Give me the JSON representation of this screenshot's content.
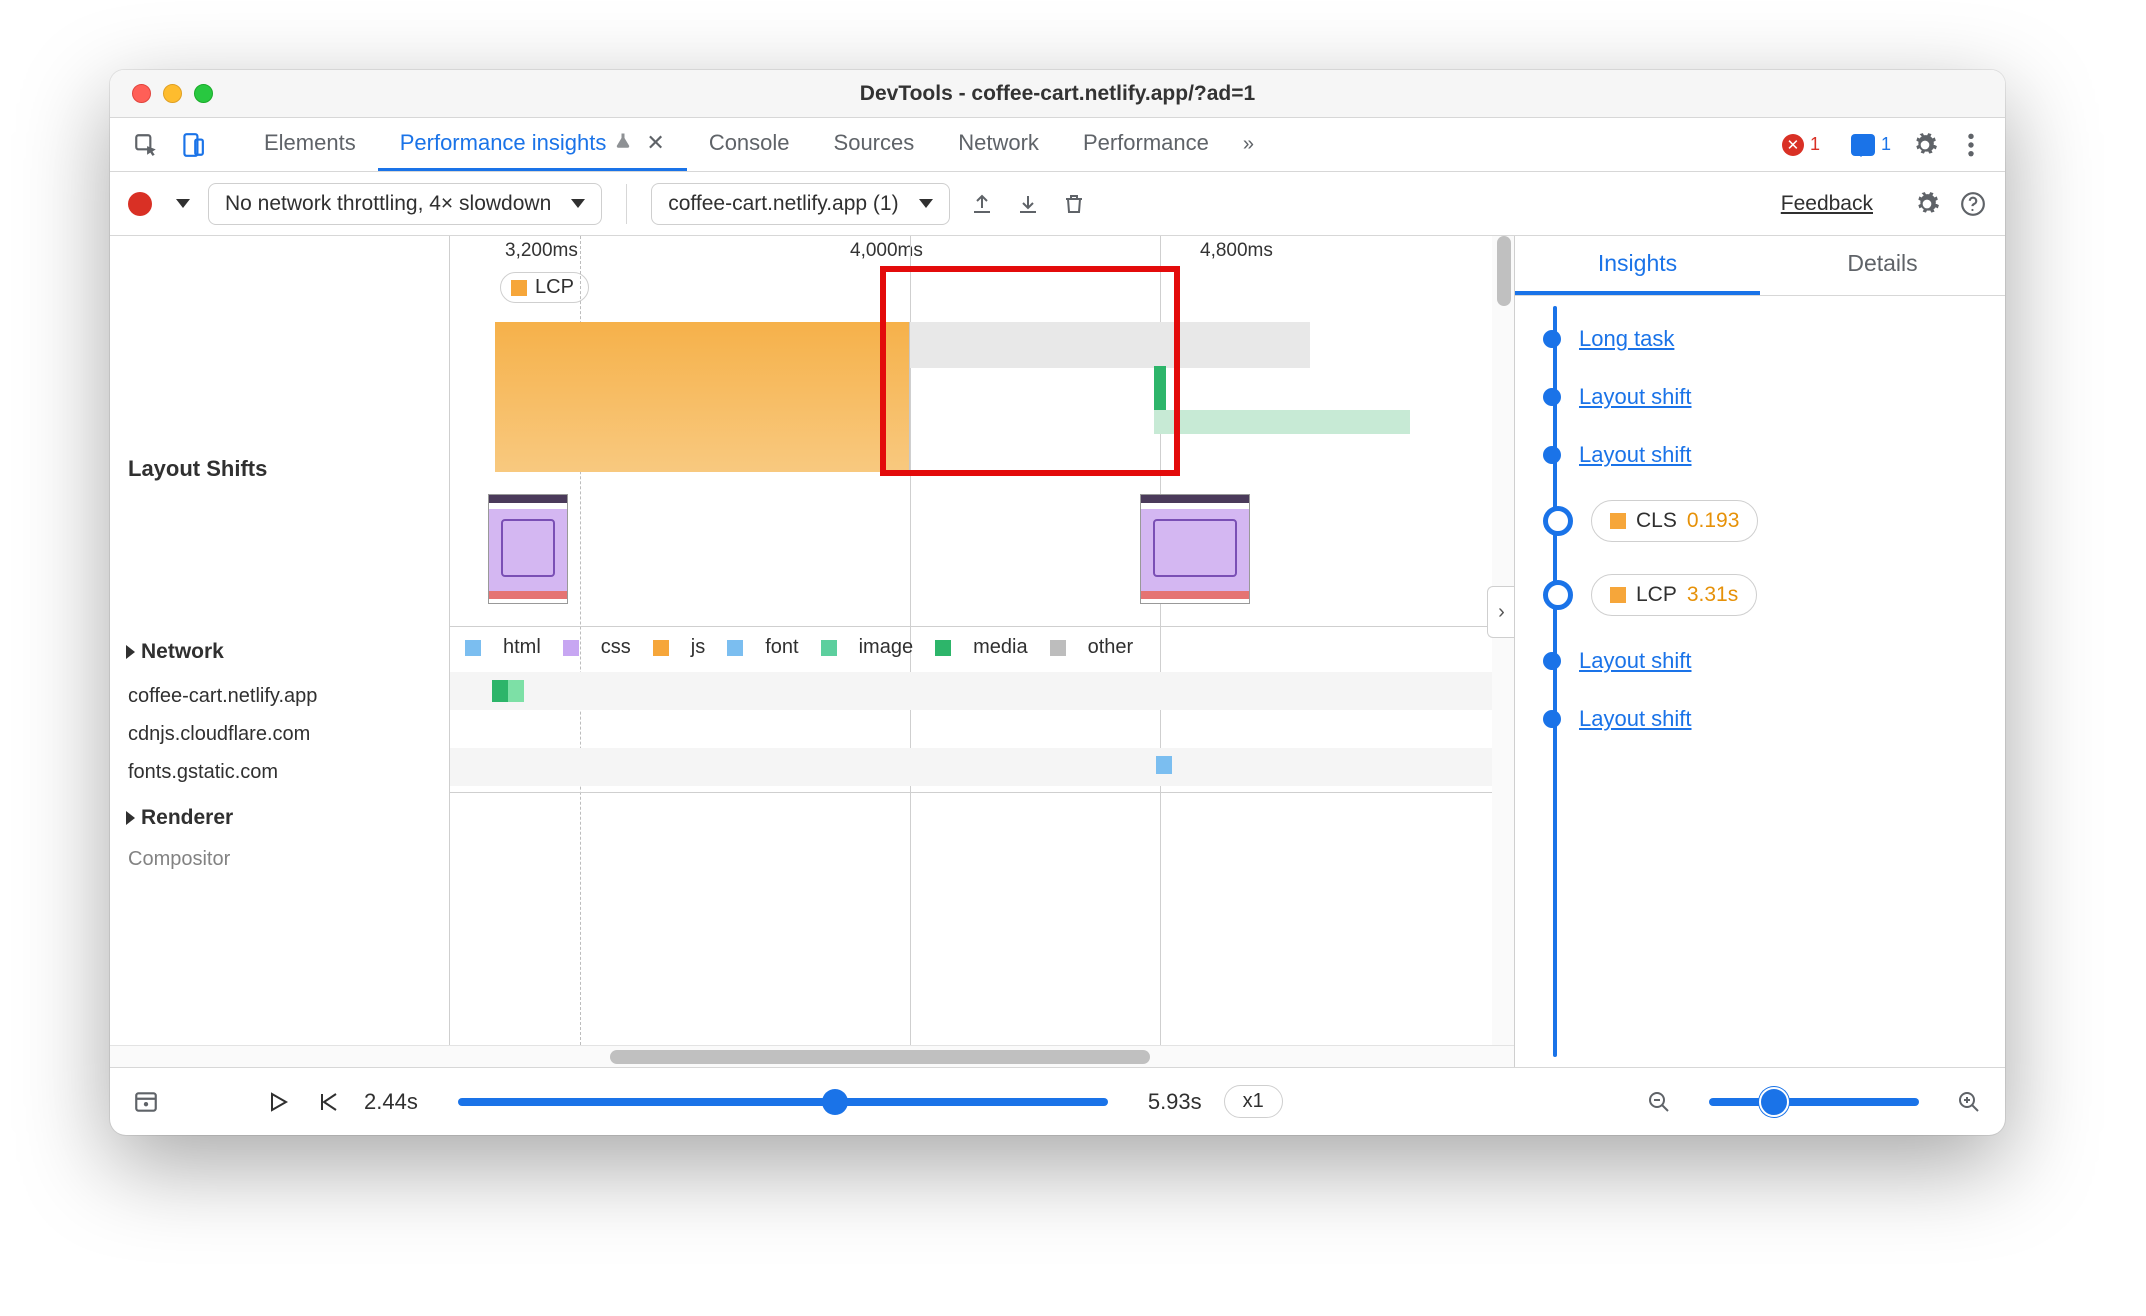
{
  "window": {
    "title": "DevTools - coffee-cart.netlify.app/?ad=1"
  },
  "tabs": {
    "elements": "Elements",
    "perf_insights": "Performance insights",
    "console": "Console",
    "sources": "Sources",
    "network": "Network",
    "performance": "Performance"
  },
  "badges": {
    "errors": "1",
    "messages": "1"
  },
  "controls": {
    "throttling": "No network throttling, 4× slowdown",
    "recording": "coffee-cart.netlify.app (1)",
    "feedback": "Feedback"
  },
  "ruler": {
    "t1": "3,200ms",
    "t2": "4,000ms",
    "t3": "4,800ms"
  },
  "lcp_marker": "LCP",
  "sections": {
    "layout_shifts": "Layout Shifts",
    "network": "Network",
    "renderer": "Renderer",
    "compositor": "Compositor"
  },
  "legend": {
    "html": "html",
    "css": "css",
    "js": "js",
    "font": "font",
    "image": "image",
    "media": "media",
    "other": "other"
  },
  "hosts": {
    "h1": "coffee-cart.netlify.app",
    "h2": "cdnjs.cloudflare.com",
    "h3": "fonts.gstatic.com"
  },
  "insights": {
    "tab_insights": "Insights",
    "tab_details": "Details",
    "events": {
      "long_task": "Long task",
      "layout_shift": "Layout shift",
      "cls_label": "CLS",
      "cls_value": "0.193",
      "lcp_label": "LCP",
      "lcp_value": "3.31s"
    }
  },
  "footer": {
    "t_start": "2.44s",
    "t_end": "5.93s",
    "speed": "x1"
  }
}
